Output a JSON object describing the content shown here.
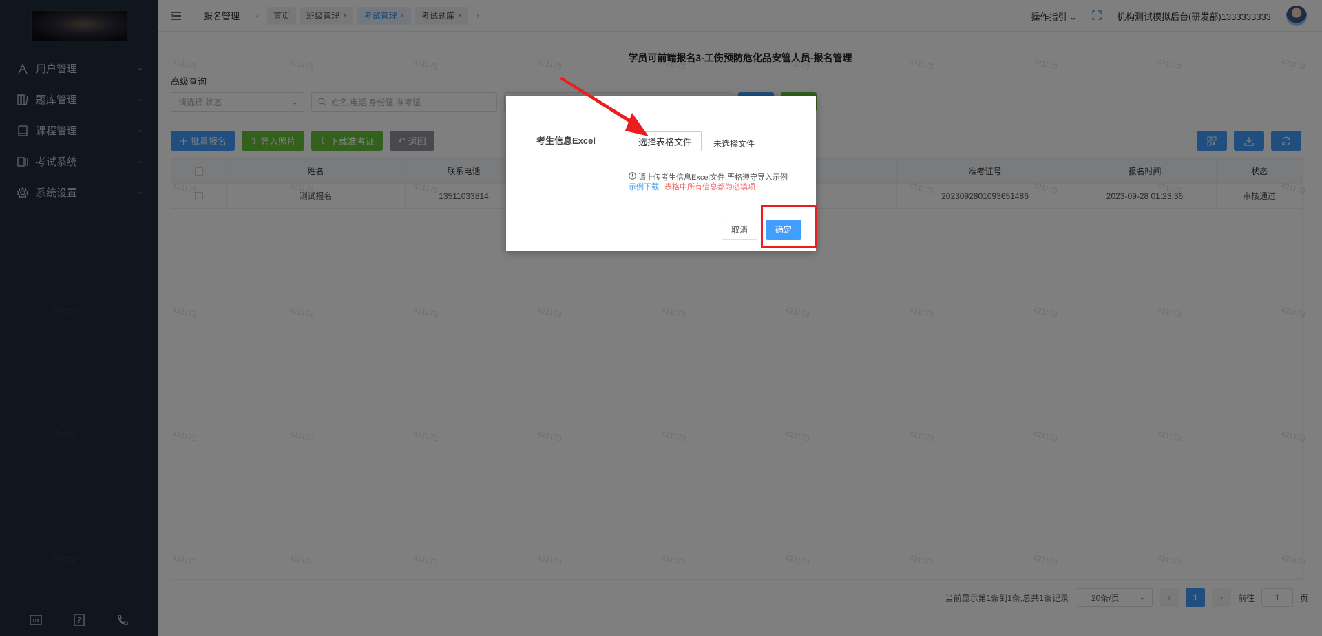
{
  "sidebar": {
    "items": [
      {
        "label": "用户管理",
        "icon": "user-management-icon"
      },
      {
        "label": "题库管理",
        "icon": "question-bank-icon"
      },
      {
        "label": "课程管理",
        "icon": "course-icon"
      },
      {
        "label": "考试系统",
        "icon": "exam-system-icon"
      },
      {
        "label": "系统设置",
        "icon": "settings-gear-icon"
      }
    ],
    "bottom_icons": [
      "screen-icon",
      "help-icon",
      "phone-icon"
    ]
  },
  "topbar": {
    "breadcrumb": "报名管理",
    "tabs": [
      {
        "label": "首页"
      },
      {
        "label": "班级管理"
      },
      {
        "label": "考试管理"
      },
      {
        "label": "考试题库"
      }
    ],
    "guide": "操作指引",
    "org": "机构测试模拟后台(研发部)1333333333"
  },
  "main": {
    "title": "学员可前端报名3-工伤预防危化品安管人员-报名管理",
    "adv_search": "高级查询",
    "status_placeholder": "请选择 状态",
    "search_placeholder": "姓名,电话,身份证,准考证",
    "buttons": {
      "batch": "批量报名",
      "import_photo": "导入照片",
      "download_ticket": "下载准考证",
      "back": "返回"
    }
  },
  "table": {
    "headers": {
      "name": "姓名",
      "phone": "联系电话",
      "ticket": "准考证号",
      "time": "报名时间",
      "status": "状态"
    },
    "rows": [
      {
        "name": "测试报名",
        "phone": "13511033814",
        "ticket": "2023092801093651486",
        "time": "2023-09-28 01:23:36",
        "status": "审核通过"
      }
    ]
  },
  "pager": {
    "summary": "当前显示第1条到1条,总共1条记录",
    "page_size": "20条/页",
    "current": "1",
    "goto_label": "前往",
    "goto_value": "1",
    "page_unit": "页"
  },
  "watermark": "421173",
  "dialog": {
    "label": "考生信息Excel",
    "choose_btn": "选择表格文件",
    "no_file": "未选择文件",
    "tip": "请上传考生信息Excel文件,严格遵守导入示例",
    "sample_link": "示例下载",
    "required_note": "表格中所有信息都为必填项",
    "cancel": "取消",
    "confirm": "确定"
  },
  "colors": {
    "primary": "#409eff",
    "success": "#67c23a",
    "sidebar": "#1f2d3d",
    "annotation": "#ee1c1c"
  }
}
